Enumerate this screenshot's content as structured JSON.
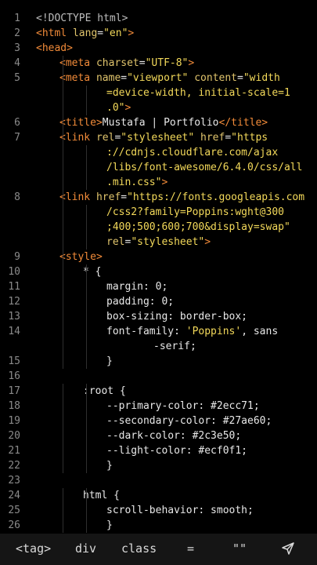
{
  "editor": {
    "lines": [
      {
        "n": "1",
        "indent": 0,
        "tokens": [
          {
            "t": "<!DOCTYPE html>",
            "c": "tk-gray"
          }
        ]
      },
      {
        "n": "2",
        "indent": 0,
        "tokens": [
          {
            "t": "<",
            "c": "tk-tag"
          },
          {
            "t": "html",
            "c": "tk-tag"
          },
          {
            "t": " lang",
            "c": "tk-attr"
          },
          {
            "t": "=",
            "c": "tk-punct"
          },
          {
            "t": "\"en\"",
            "c": "tk-str"
          },
          {
            "t": ">",
            "c": "tk-tag"
          }
        ]
      },
      {
        "n": "3",
        "indent": 0,
        "tokens": [
          {
            "t": "<head>",
            "c": "tk-tag"
          }
        ]
      },
      {
        "n": "4",
        "indent": 1,
        "tokens": [
          {
            "t": "<meta",
            "c": "tk-tag"
          },
          {
            "t": " charset",
            "c": "tk-attr"
          },
          {
            "t": "=",
            "c": "tk-punct"
          },
          {
            "t": "\"UTF-8\"",
            "c": "tk-str"
          },
          {
            "t": ">",
            "c": "tk-tag"
          }
        ]
      },
      {
        "n": "5",
        "indent": 1,
        "tokens": [
          {
            "t": "<meta",
            "c": "tk-tag"
          },
          {
            "t": " name",
            "c": "tk-attr"
          },
          {
            "t": "=",
            "c": "tk-punct"
          },
          {
            "t": "\"viewport\"",
            "c": "tk-str"
          },
          {
            "t": " content",
            "c": "tk-attr"
          },
          {
            "t": "=",
            "c": "tk-punct"
          },
          {
            "t": "\"width",
            "c": "tk-str"
          }
        ]
      },
      {
        "n": "",
        "indent": 3,
        "tokens": [
          {
            "t": "=device-width, initial-scale=1",
            "c": "tk-str"
          }
        ]
      },
      {
        "n": "",
        "indent": 3,
        "tokens": [
          {
            "t": ".0\"",
            "c": "tk-str"
          },
          {
            "t": ">",
            "c": "tk-tag"
          }
        ]
      },
      {
        "n": "6",
        "indent": 1,
        "tokens": [
          {
            "t": "<title>",
            "c": "tk-tag"
          },
          {
            "t": "Mustafa | Portfolio",
            "c": "tk-text"
          },
          {
            "t": "</title>",
            "c": "tk-tag"
          }
        ]
      },
      {
        "n": "7",
        "indent": 1,
        "tokens": [
          {
            "t": "<link",
            "c": "tk-tag"
          },
          {
            "t": " rel",
            "c": "tk-attr"
          },
          {
            "t": "=",
            "c": "tk-punct"
          },
          {
            "t": "\"stylesheet\"",
            "c": "tk-str"
          },
          {
            "t": " href",
            "c": "tk-attr"
          },
          {
            "t": "=",
            "c": "tk-punct"
          },
          {
            "t": "\"https",
            "c": "tk-str"
          }
        ]
      },
      {
        "n": "",
        "indent": 3,
        "tokens": [
          {
            "t": "://cdnjs.cloudflare.com/ajax",
            "c": "tk-str"
          }
        ]
      },
      {
        "n": "",
        "indent": 3,
        "tokens": [
          {
            "t": "/libs/font-awesome/6.4.0/css/all",
            "c": "tk-str"
          }
        ]
      },
      {
        "n": "",
        "indent": 3,
        "tokens": [
          {
            "t": ".min.css\"",
            "c": "tk-str"
          },
          {
            "t": ">",
            "c": "tk-tag"
          }
        ]
      },
      {
        "n": "8",
        "indent": 1,
        "tokens": [
          {
            "t": "<link",
            "c": "tk-tag"
          },
          {
            "t": " href",
            "c": "tk-attr"
          },
          {
            "t": "=",
            "c": "tk-punct"
          },
          {
            "t": "\"https://fonts.googleapis.com",
            "c": "tk-str"
          }
        ]
      },
      {
        "n": "",
        "indent": 3,
        "tokens": [
          {
            "t": "/css2?family=Poppins:wght@300",
            "c": "tk-str"
          }
        ]
      },
      {
        "n": "",
        "indent": 3,
        "tokens": [
          {
            "t": ";400;500;600;700&display=swap\"",
            "c": "tk-str"
          }
        ]
      },
      {
        "n": "",
        "indent": 3,
        "tokens": [
          {
            "t": "rel",
            "c": "tk-attr"
          },
          {
            "t": "=",
            "c": "tk-punct"
          },
          {
            "t": "\"stylesheet\"",
            "c": "tk-str"
          },
          {
            "t": ">",
            "c": "tk-tag"
          }
        ]
      },
      {
        "n": "9",
        "indent": 1,
        "tokens": [
          {
            "t": "<style>",
            "c": "tk-tag"
          }
        ]
      },
      {
        "n": "10",
        "indent": 2,
        "tokens": [
          {
            "t": "* {",
            "c": "tk-text"
          }
        ]
      },
      {
        "n": "11",
        "indent": 3,
        "tokens": [
          {
            "t": "margin: 0;",
            "c": "tk-text"
          }
        ]
      },
      {
        "n": "12",
        "indent": 3,
        "tokens": [
          {
            "t": "padding: 0;",
            "c": "tk-text"
          }
        ]
      },
      {
        "n": "13",
        "indent": 3,
        "tokens": [
          {
            "t": "box-sizing: border-box;",
            "c": "tk-text"
          }
        ]
      },
      {
        "n": "14",
        "indent": 3,
        "tokens": [
          {
            "t": "font-family: ",
            "c": "tk-text"
          },
          {
            "t": "'Poppins'",
            "c": "tk-str"
          },
          {
            "t": ", sans",
            "c": "tk-text"
          }
        ]
      },
      {
        "n": "",
        "indent": 5,
        "tokens": [
          {
            "t": "-serif;",
            "c": "tk-text"
          }
        ]
      },
      {
        "n": "15",
        "indent": 3,
        "tokens": [
          {
            "t": "}",
            "c": "tk-text"
          }
        ]
      },
      {
        "n": "16",
        "indent": 0,
        "tokens": []
      },
      {
        "n": "17",
        "indent": 2,
        "tokens": [
          {
            "t": ":root {",
            "c": "tk-text"
          }
        ]
      },
      {
        "n": "18",
        "indent": 3,
        "tokens": [
          {
            "t": "--primary-color: #2ecc71;",
            "c": "tk-text"
          }
        ]
      },
      {
        "n": "19",
        "indent": 3,
        "tokens": [
          {
            "t": "--secondary-color: #27ae60;",
            "c": "tk-text"
          }
        ]
      },
      {
        "n": "20",
        "indent": 3,
        "tokens": [
          {
            "t": "--dark-color: #2c3e50;",
            "c": "tk-text"
          }
        ]
      },
      {
        "n": "21",
        "indent": 3,
        "tokens": [
          {
            "t": "--light-color: #ecf0f1;",
            "c": "tk-text"
          }
        ]
      },
      {
        "n": "22",
        "indent": 3,
        "tokens": [
          {
            "t": "}",
            "c": "tk-text"
          }
        ]
      },
      {
        "n": "23",
        "indent": 0,
        "tokens": []
      },
      {
        "n": "24",
        "indent": 2,
        "tokens": [
          {
            "t": "html {",
            "c": "tk-text"
          }
        ]
      },
      {
        "n": "25",
        "indent": 3,
        "tokens": [
          {
            "t": "scroll-behavior: smooth;",
            "c": "tk-text"
          }
        ]
      },
      {
        "n": "26",
        "indent": 3,
        "tokens": [
          {
            "t": "}",
            "c": "tk-text"
          }
        ]
      }
    ]
  },
  "keyboard_bar": {
    "tag": "<tag>",
    "div": "div",
    "class": "class",
    "equals": "=",
    "quotes": "\"\"",
    "send_icon": "send-icon"
  },
  "colors": {
    "background": "#000000",
    "line_number": "#8a8a8a",
    "tag": "#f28b39",
    "attribute": "#e0c46c",
    "string": "#f3d95a",
    "text": "#e8e8e8",
    "bar_background": "#151515"
  }
}
